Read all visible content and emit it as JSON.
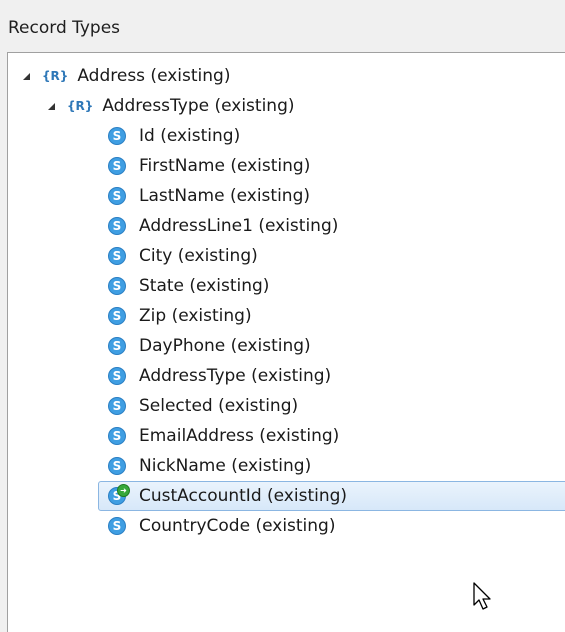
{
  "panel": {
    "title": "Record Types"
  },
  "tree": {
    "root": {
      "label": "Address (existing)",
      "icon": "record-icon",
      "icon_text": "{R}"
    },
    "child": {
      "label": "AddressType (existing)",
      "icon": "record-icon",
      "icon_text": "{R}"
    },
    "fields": [
      {
        "label": "Id (existing)",
        "icon": "string-field-icon"
      },
      {
        "label": "FirstName (existing)",
        "icon": "string-field-icon"
      },
      {
        "label": "LastName (existing)",
        "icon": "string-field-icon"
      },
      {
        "label": "AddressLine1 (existing)",
        "icon": "string-field-icon"
      },
      {
        "label": "City (existing)",
        "icon": "string-field-icon"
      },
      {
        "label": "State (existing)",
        "icon": "string-field-icon"
      },
      {
        "label": "Zip (existing)",
        "icon": "string-field-icon"
      },
      {
        "label": "DayPhone (existing)",
        "icon": "string-field-icon"
      },
      {
        "label": "AddressType (existing)",
        "icon": "string-field-icon"
      },
      {
        "label": "Selected (existing)",
        "icon": "string-field-icon"
      },
      {
        "label": "EmailAddress (existing)",
        "icon": "string-field-icon"
      },
      {
        "label": "NickName (existing)",
        "icon": "string-field-icon"
      },
      {
        "label": "CustAccountId (existing)",
        "icon": "foreign-key-field-icon",
        "selected": true
      },
      {
        "label": "CountryCode (existing)",
        "icon": "string-field-icon"
      }
    ],
    "field_icon_glyph": "S"
  },
  "colors": {
    "accent": "#3f9ee2",
    "selection_border": "#8bb6e2",
    "record_icon": "#2f78b8"
  }
}
